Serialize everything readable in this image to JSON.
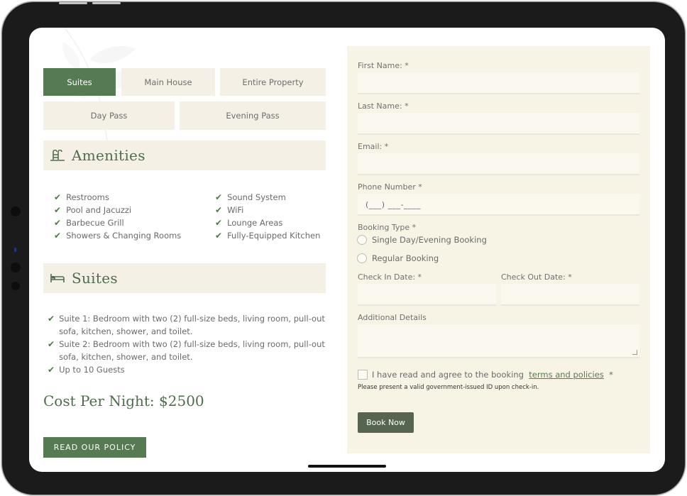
{
  "tabs": [
    {
      "label": "Suites",
      "active": true
    },
    {
      "label": "Main House",
      "active": false
    },
    {
      "label": "Entire Property",
      "active": false
    },
    {
      "label": "Day Pass",
      "active": false
    },
    {
      "label": "Evening Pass",
      "active": false
    }
  ],
  "amenities": {
    "title": "Amenities",
    "icon": "pool-ladder-icon",
    "left": [
      "Restrooms",
      "Pool and Jacuzzi",
      "Barbecue Grill",
      "Showers & Changing Rooms"
    ],
    "right": [
      "Sound System",
      "WiFi",
      "Lounge Areas",
      "Fully-Equipped Kitchen"
    ]
  },
  "suites": {
    "title": "Suites",
    "icon": "bed-icon",
    "items": [
      "Suite 1: Bedroom with two (2) full-size beds, living room, pull-out sofa, kitchen, shower, and toilet.",
      "Suite 2: Bedroom with two (2) full-size beds, living room, pull-out sofa, kitchen, shower, and toilet.",
      "Up to 10 Guests"
    ]
  },
  "cost": "Cost Per Night: $2500",
  "policy_button": "READ OUR POLICY",
  "form": {
    "first_name_label": "First Name: *",
    "last_name_label": "Last Name: *",
    "email_label": "Email: *",
    "phone_label": "Phone Number *",
    "phone_placeholder": "(___) ___-____",
    "booking_type_label": "Booking Type *",
    "booking_options": [
      "Single Day/Evening Booking",
      "Regular Booking"
    ],
    "check_in_label": "Check In Date: *",
    "check_out_label": "Check Out Date: *",
    "details_label": "Additional Details",
    "agree_text": "I have read and agree to the booking",
    "agree_link": "terms and policies",
    "agree_required": "*",
    "note": "Please present a valid government-issued ID upon check-in.",
    "submit": "Book Now"
  },
  "colors": {
    "accent": "#567b52",
    "panel": "#f7f4e6",
    "tab_bg": "#f5f0e6"
  }
}
